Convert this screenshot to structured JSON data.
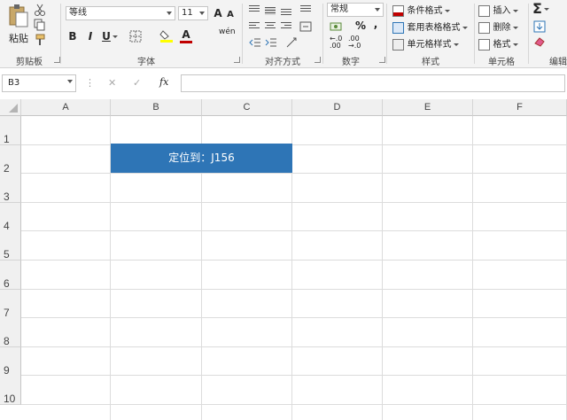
{
  "clipboard": {
    "paste_label": "粘贴",
    "group_label": "剪贴板"
  },
  "font": {
    "name": "等线",
    "size": "11",
    "grow": "A",
    "shrink": "A",
    "bold": "B",
    "italic": "I",
    "underline": "U",
    "font_color_letter": "A",
    "phonetic": "wén",
    "group_label": "字体"
  },
  "alignment": {
    "group_label": "对齐方式"
  },
  "number": {
    "format": "常规",
    "percent": "%",
    "comma": ",",
    "group_label": "数字"
  },
  "styles": {
    "conditional": "条件格式",
    "table": "套用表格格式",
    "cell": "单元格样式",
    "group_label": "样式"
  },
  "cells": {
    "insert": "插入",
    "delete": "删除",
    "format": "格式",
    "group_label": "单元格"
  },
  "editing": {
    "group_label": "编辑"
  },
  "formula_bar": {
    "name_box": "B3",
    "cancel": "✕",
    "confirm": "✓",
    "fx": "fx",
    "value": ""
  },
  "grid": {
    "columns": [
      "A",
      "B",
      "C",
      "D",
      "E",
      "F"
    ],
    "rows": [
      "1",
      "2",
      "3",
      "4",
      "5",
      "6",
      "7",
      "8",
      "9",
      "10"
    ]
  },
  "banner": {
    "text": "定位到：J156"
  },
  "colors": {
    "banner_bg": "#2e75b6",
    "font_color_bar": "#c00000",
    "fill_bar": "#ffff00"
  }
}
